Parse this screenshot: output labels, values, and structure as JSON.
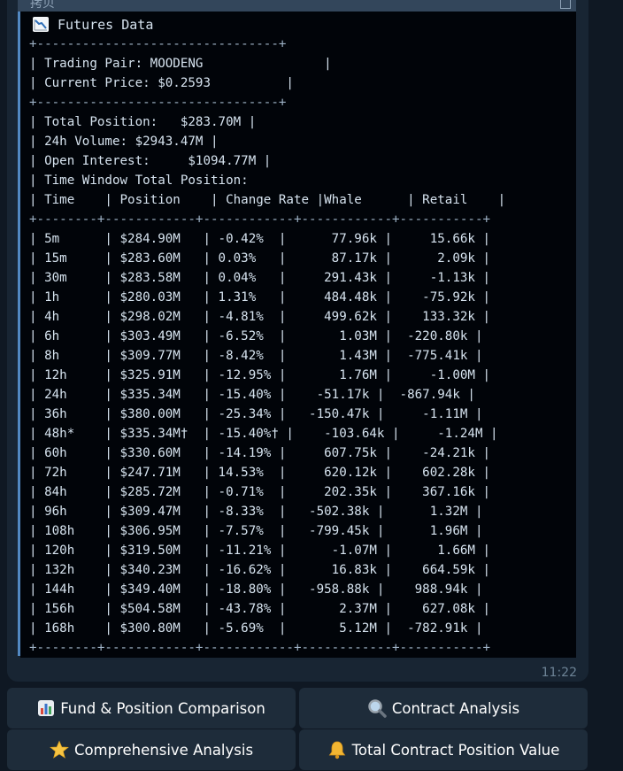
{
  "copy_label": "拷贝",
  "title": "Futures Data",
  "lines": [
    "+--------------------------------+",
    "| Trading Pair: MOODENG                |",
    "| Current Price: $0.2593          |",
    "+--------------------------------+",
    "| Total Position:   $283.70M |",
    "| 24h Volume: $2943.47M |",
    "| Open Interest:     $1094.77M |",
    "| Time Window Total Position:",
    "| Time    | Position    | Change Rate |Whale      | Retail    |",
    "+--------+------------+------------+------------+-----------+",
    "| 5m      | $284.90M   | -0.42%  |      77.96k |     15.66k |",
    "| 15m     | $283.60M   | 0.03%   |      87.17k |      2.09k |",
    "| 30m     | $283.58M   | 0.04%   |     291.43k |     -1.13k |",
    "| 1h      | $280.03M   | 1.31%   |     484.48k |    -75.92k |",
    "| 4h      | $298.02M   | -4.81%  |     499.62k |    133.32k |",
    "| 6h      | $303.49M   | -6.52%  |       1.03M |  -220.80k |",
    "| 8h      | $309.77M   | -8.42%  |       1.43M |  -775.41k |",
    "| 12h     | $325.91M   | -12.95% |       1.76M |     -1.00M |",
    "| 24h     | $335.34M   | -15.40% |    -51.17k |  -867.94k |",
    "| 36h     | $380.00M   | -25.34% |   -150.47k |     -1.11M |",
    "| 48h*    | $335.34M†  | -15.40%† |    -103.64k |     -1.24M |",
    "| 60h     | $330.60M   | -14.19% |     607.75k |    -24.21k |",
    "| 72h     | $247.71M   | 14.53%  |     620.12k |    602.28k |",
    "| 84h     | $285.72M   | -0.71%  |     202.35k |    367.16k |",
    "| 96h     | $309.47M   | -8.33%  |   -502.38k |      1.32M |",
    "| 108h    | $306.95M   | -7.57%  |   -799.45k |      1.96M |",
    "| 120h    | $319.50M   | -11.21% |      -1.07M |      1.66M |",
    "| 132h    | $340.23M   | -16.62% |      16.83k |    664.59k |",
    "| 144h    | $349.40M   | -18.80% |   -958.88k |    988.94k |",
    "| 156h    | $504.58M   | -43.78% |       2.37M |    627.08k |",
    "| 168h    | $300.80M   | -5.69%  |       5.12M |  -782.91k |",
    "+--------+------------+------------+------------+-----------+"
  ],
  "timestamp": "11:22",
  "buttons": {
    "fund_position": "Fund & Position Comparison",
    "contract_analysis": "Contract Analysis",
    "comprehensive": "Comprehensive Analysis",
    "total_contract": "Total Contract Position Value"
  },
  "icons": {
    "title": "chart-decreasing-icon",
    "fund_position": "bar-chart-icon",
    "contract_analysis": "magnifier-icon",
    "comprehensive": "star-icon",
    "total_contract": "bell-icon"
  },
  "colors": {
    "background": "#0f1823",
    "bubble": "#182533",
    "code_background": "#010409",
    "quote_bar": "#5288c1",
    "text": "#d6e3ef",
    "button": "#1e2c3a"
  }
}
